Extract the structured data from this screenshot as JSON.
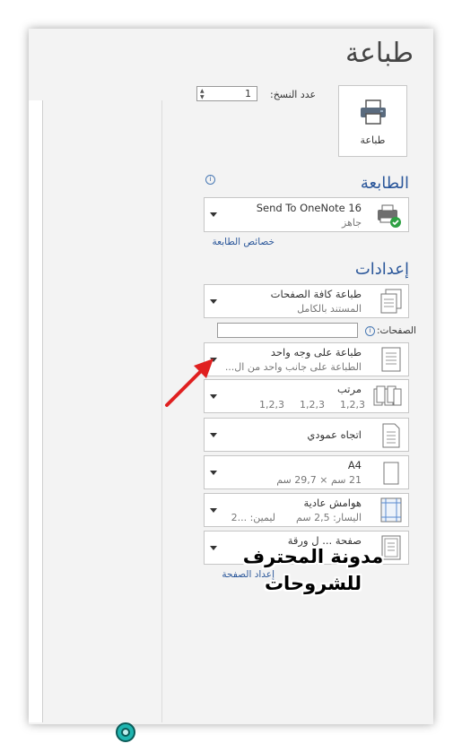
{
  "title": "طباعة",
  "print_button": {
    "label": "طباعة",
    "icon": "printer-icon"
  },
  "copies": {
    "label": "عدد النسخ:",
    "value": "1"
  },
  "printer": {
    "heading": "الطابعة",
    "name": "Send To OneNote 16",
    "status": "جاهز",
    "properties_link": "خصائص الطابعة",
    "status_color": "#2ea043"
  },
  "settings": {
    "heading": "إعدادات",
    "items": [
      {
        "title": "طباعة كافة الصفحات",
        "subtitle": "المستند بالكامل"
      },
      {
        "title": "طباعة على وجه واحد",
        "subtitle": "الطباعة على جانب واحد من ال..."
      },
      {
        "title": "مرتب",
        "subtitle_parts": [
          "1,2,3",
          "1,2,3",
          "1,2,3"
        ]
      },
      {
        "title": "اتجاه عمودي"
      },
      {
        "title": "A4",
        "subtitle": "21 سم × 29,7 سم"
      },
      {
        "title": "هوامش عادية",
        "subtitle_left": "اليسار: 2,5 سم",
        "subtitle_right": "ليمين: ...2"
      },
      {
        "title": "صفحة ... ل ورقة"
      }
    ],
    "pages_label": "الصفحات:",
    "page_setup_link": "إعداد الصفحة"
  },
  "watermark": {
    "line1": "مدونة المحترف",
    "line2": "للشروحات"
  },
  "colors": {
    "accent": "#2b579a",
    "annotation_arrow": "#e02020"
  }
}
